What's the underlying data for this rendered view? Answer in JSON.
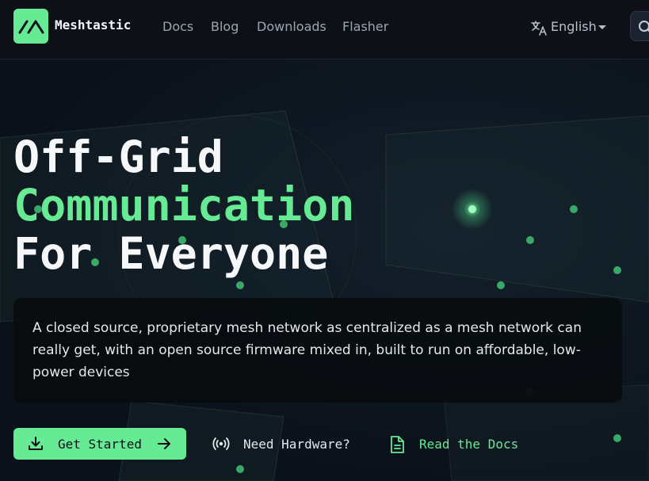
{
  "brand": {
    "name": "Meshtastic"
  },
  "nav": {
    "links": [
      {
        "label": "Docs"
      },
      {
        "label": "Blog"
      },
      {
        "label": "Downloads"
      },
      {
        "label": "Flasher"
      }
    ],
    "language": {
      "label": "English"
    }
  },
  "hero": {
    "headline": {
      "line1": "Off-Grid",
      "line2": "Communication",
      "line3": "For Everyone"
    },
    "description": "A closed source, proprietary mesh network as centralized as a mesh network can really get, with an open source firmware mixed in, built to run on affordable, low-power devices",
    "buttons": {
      "get_started": "Get Started",
      "need_hardware": "Need Hardware?",
      "read_docs": "Read the Docs"
    }
  },
  "colors": {
    "accent": "#67ea94",
    "background": "#0b111a",
    "nav_background": "#0d1117"
  },
  "icons": {
    "logo": "meshtastic-logo-icon",
    "translate": "translate-icon",
    "caret": "caret-down-icon",
    "search": "search-icon",
    "download": "download-icon",
    "arrow": "arrow-right-icon",
    "radio": "radio-signal-icon",
    "document": "document-icon"
  }
}
